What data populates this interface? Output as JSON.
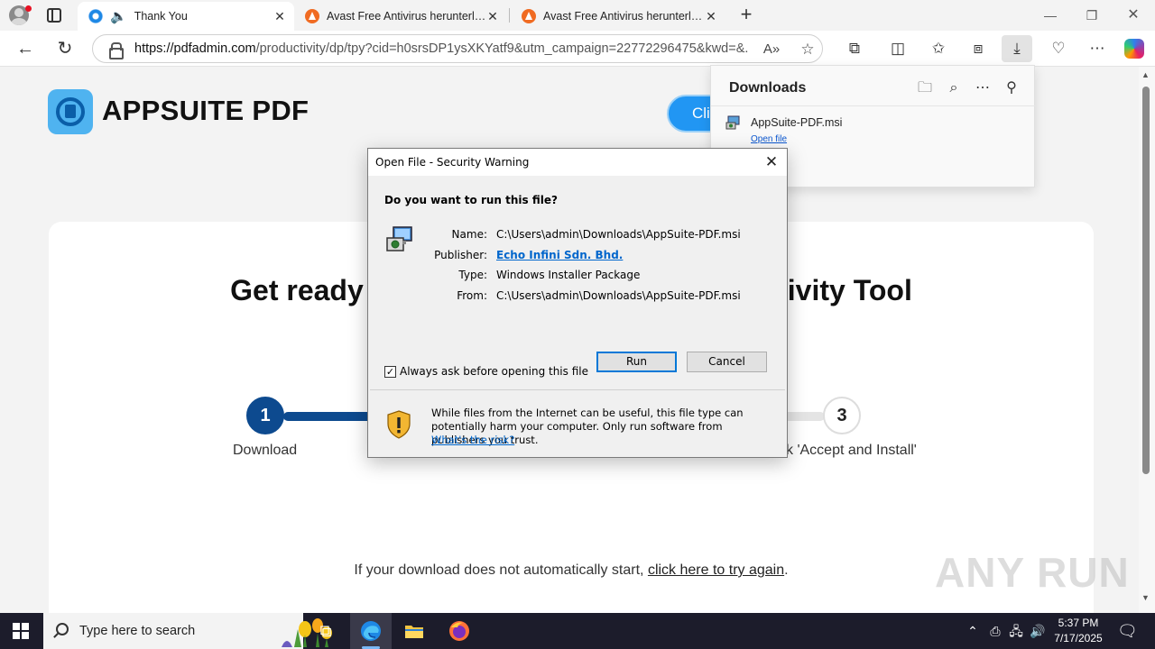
{
  "browser": {
    "tabs": [
      {
        "title": "Thank You",
        "active": true
      },
      {
        "title": "Avast Free Antivirus herunterladen",
        "active": false
      },
      {
        "title": "Avast Free Antivirus herunterladen",
        "active": false
      }
    ],
    "url_host": "https://pdfadmin.com",
    "url_path": "/productivity/dp/tpy?cid=h0srsDP1ysXKYatf9&utm_campaign=22772296475&kwd=&..."
  },
  "page": {
    "brand": "APPSUITE PDF",
    "cta_label": "Cli",
    "headline_left": "Get ready",
    "headline_right": "ivity Tool",
    "step1_number": "1",
    "step1_label": "Download",
    "step3_number": "3",
    "step3_label": "k 'Accept and Install'",
    "footer_prefix": "If your download does not automatically start,",
    "footer_link": "click here to try again",
    "footer_suffix": ".",
    "watermark": "ANY RUN"
  },
  "downloads": {
    "title": "Downloads",
    "file_name": "AppSuite-PDF.msi",
    "open_link": "Open file"
  },
  "dialog": {
    "title": "Open File - Security Warning",
    "question": "Do you want to run this file?",
    "name_label": "Name:",
    "name_value": "C:\\Users\\admin\\Downloads\\AppSuite-PDF.msi",
    "publisher_label": "Publisher:",
    "publisher_value": "Echo Infini Sdn. Bhd.",
    "type_label": "Type:",
    "type_value": "Windows Installer Package",
    "from_label": "From:",
    "from_value": "C:\\Users\\admin\\Downloads\\AppSuite-PDF.msi",
    "run_label": "Run",
    "cancel_label": "Cancel",
    "checkbox_label": "Always ask before opening this file",
    "checkbox_checked": true,
    "warning_text": "While files from the Internet can be useful, this file type can potentially harm your computer. Only run software from publishers you trust.",
    "warning_link": "What's the risk?"
  },
  "taskbar": {
    "search_placeholder": "Type here to search",
    "time": "5:37 PM",
    "date": "7/17/2025"
  },
  "colors": {
    "accent_blue": "#0d4a8f",
    "link_blue": "#0066cc",
    "taskbar": "#1c1c2b"
  }
}
